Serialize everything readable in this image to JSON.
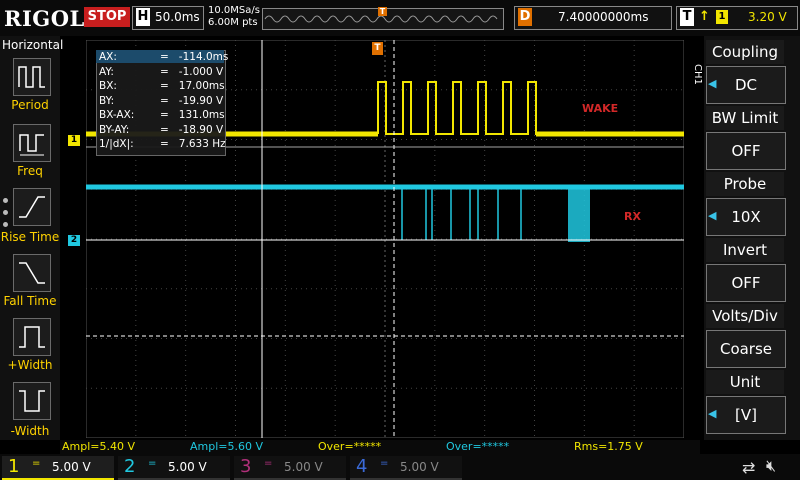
{
  "topbar": {
    "brand": "RIGOL",
    "run_state": "STOP",
    "timebase_letter": "H",
    "timebase": "50.0ms",
    "sample_rate": "10.0MSa/s",
    "memory_depth": "6.00M pts",
    "trigger_marker": "T",
    "delay_letter": "D",
    "delay": "7.40000000ms",
    "trigger_letter": "T",
    "trigger_edge": "↑",
    "trigger_source": "1",
    "trigger_level": "3.20 V"
  },
  "left_menu": {
    "title": "Horizontal",
    "items": [
      {
        "label": "Period",
        "icon": "period-icon"
      },
      {
        "label": "Freq",
        "icon": "freq-icon"
      },
      {
        "label": "Rise Time",
        "icon": "rise-time-icon"
      },
      {
        "label": "Fall Time",
        "icon": "fall-time-icon"
      },
      {
        "label": "+Width",
        "icon": "pos-width-icon"
      },
      {
        "label": "-Width",
        "icon": "neg-width-icon"
      }
    ]
  },
  "right_menu": {
    "channel_tag": "CH1",
    "items": [
      {
        "title": "Coupling",
        "value": "DC"
      },
      {
        "title": "BW Limit",
        "value": "OFF"
      },
      {
        "title": "Probe",
        "value": "10X"
      },
      {
        "title": "Invert",
        "value": "OFF"
      },
      {
        "title": "Volts/Div",
        "value": "Coarse"
      },
      {
        "title": "Unit",
        "value": "[V]"
      }
    ]
  },
  "cursor": {
    "rows": [
      {
        "label": "AX:",
        "value": "=   -114.0ms"
      },
      {
        "label": "AY:",
        "value": "=   -1.000 V"
      },
      {
        "label": "BX:",
        "value": "=   17.00ms"
      },
      {
        "label": "BY:",
        "value": "=   -19.90 V"
      },
      {
        "label": "BX-AX:",
        "value": "=   131.0ms"
      },
      {
        "label": "BY-AY:",
        "value": "=   -18.90 V"
      },
      {
        "label": "1/|dX|:",
        "value": "=   7.633 Hz"
      }
    ]
  },
  "annotations": {
    "wake": "WAKE",
    "rx": "RX"
  },
  "markers": {
    "ch1": "1",
    "ch2": "2",
    "trigger_pos": "T"
  },
  "measurements": [
    {
      "text": "Ampl=5.40 V",
      "color": "#f2e600"
    },
    {
      "text": "Ampl=5.60 V",
      "color": "#20c8e0"
    },
    {
      "text": "Over=*****",
      "color": "#f2e600"
    },
    {
      "text": "Over=*****",
      "color": "#20c8e0"
    },
    {
      "text": "Rms=1.75 V",
      "color": "#f2e600"
    }
  ],
  "channels": [
    {
      "num": "1",
      "coupling": "=",
      "scale": "5.00 V",
      "color": "#f2e600",
      "active": true
    },
    {
      "num": "2",
      "coupling": "=",
      "scale": "5.00 V",
      "color": "#20c8e0",
      "active": false
    },
    {
      "num": "3",
      "coupling": "=",
      "scale": "5.00 V",
      "color": "#b0307a",
      "active": false
    },
    {
      "num": "4",
      "coupling": "=",
      "scale": "5.00 V",
      "color": "#3a6ad8",
      "active": false
    }
  ],
  "colors": {
    "ch1": "#f2e600",
    "ch2": "#20c8e0",
    "accent": "#e07000",
    "stop": "#c81e1e"
  },
  "status_icons": [
    "usb-icon",
    "speaker-icon"
  ]
}
